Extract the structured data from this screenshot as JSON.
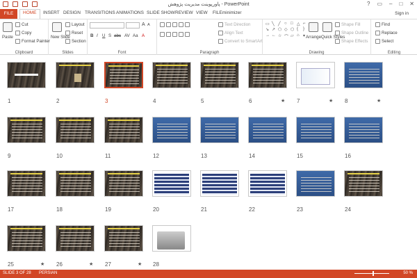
{
  "window": {
    "title": "پاورپوینت مدیریت پژوهش - PowerPoint",
    "controls": [
      "?",
      "▭",
      "–",
      "□",
      "✕"
    ]
  },
  "tabs": [
    "FILE",
    "HOME",
    "INSERT",
    "DESIGN",
    "TRANSITIONS",
    "ANIMATIONS",
    "SLIDE SHOW",
    "REVIEW",
    "VIEW",
    "FILEminimizer"
  ],
  "signin": "Sign in",
  "ribbon": {
    "clipboard": {
      "paste": "Paste",
      "cut": "Cut",
      "copy": "Copy",
      "format_painter": "Format Painter",
      "label": "Clipboard"
    },
    "slides": {
      "new_slide": "New Slide",
      "layout": "Layout",
      "reset": "Reset",
      "section": "Section",
      "label": "Slides"
    },
    "font": {
      "label": "Font",
      "bold": "B",
      "italic": "I",
      "underline": "U",
      "strike": "S",
      "abc": "abc",
      "av": "AV",
      "aa": "Aa",
      "grow": "A",
      "shrink": "A"
    },
    "paragraph": {
      "text_direction": "Text Direction",
      "align_text": "Align Text",
      "smartart": "Convert to SmartArt",
      "label": "Paragraph"
    },
    "drawing": {
      "arrange": "Arrange",
      "quick_styles": "Quick Styles",
      "shape_fill": "Shape Fill",
      "shape_outline": "Shape Outline",
      "shape_effects": "Shape Effects",
      "label": "Drawing"
    },
    "editing": {
      "find": "Find",
      "replace": "Replace",
      "select": "Select",
      "label": "Editing"
    }
  },
  "slides": [
    {
      "n": "1",
      "star": ""
    },
    {
      "n": "2",
      "star": ""
    },
    {
      "n": "3",
      "star": ""
    },
    {
      "n": "4",
      "star": ""
    },
    {
      "n": "5",
      "star": ""
    },
    {
      "n": "6",
      "star": "★"
    },
    {
      "n": "7",
      "star": "★"
    },
    {
      "n": "8",
      "star": "★"
    },
    {
      "n": "9",
      "star": ""
    },
    {
      "n": "10",
      "star": ""
    },
    {
      "n": "11",
      "star": ""
    },
    {
      "n": "12",
      "star": ""
    },
    {
      "n": "13",
      "star": ""
    },
    {
      "n": "14",
      "star": ""
    },
    {
      "n": "15",
      "star": ""
    },
    {
      "n": "16",
      "star": ""
    },
    {
      "n": "17",
      "star": ""
    },
    {
      "n": "18",
      "star": ""
    },
    {
      "n": "19",
      "star": ""
    },
    {
      "n": "20",
      "star": ""
    },
    {
      "n": "21",
      "star": ""
    },
    {
      "n": "22",
      "star": ""
    },
    {
      "n": "23",
      "star": ""
    },
    {
      "n": "24",
      "star": ""
    },
    {
      "n": "25",
      "star": "★"
    },
    {
      "n": "26",
      "star": "★"
    },
    {
      "n": "27",
      "star": "★"
    },
    {
      "n": "28",
      "star": ""
    }
  ],
  "status": {
    "slide": "SLIDE 3 OF 28",
    "language": "PERSIAN",
    "zoom": "50 %"
  },
  "colors": {
    "accent": "#d24726"
  }
}
